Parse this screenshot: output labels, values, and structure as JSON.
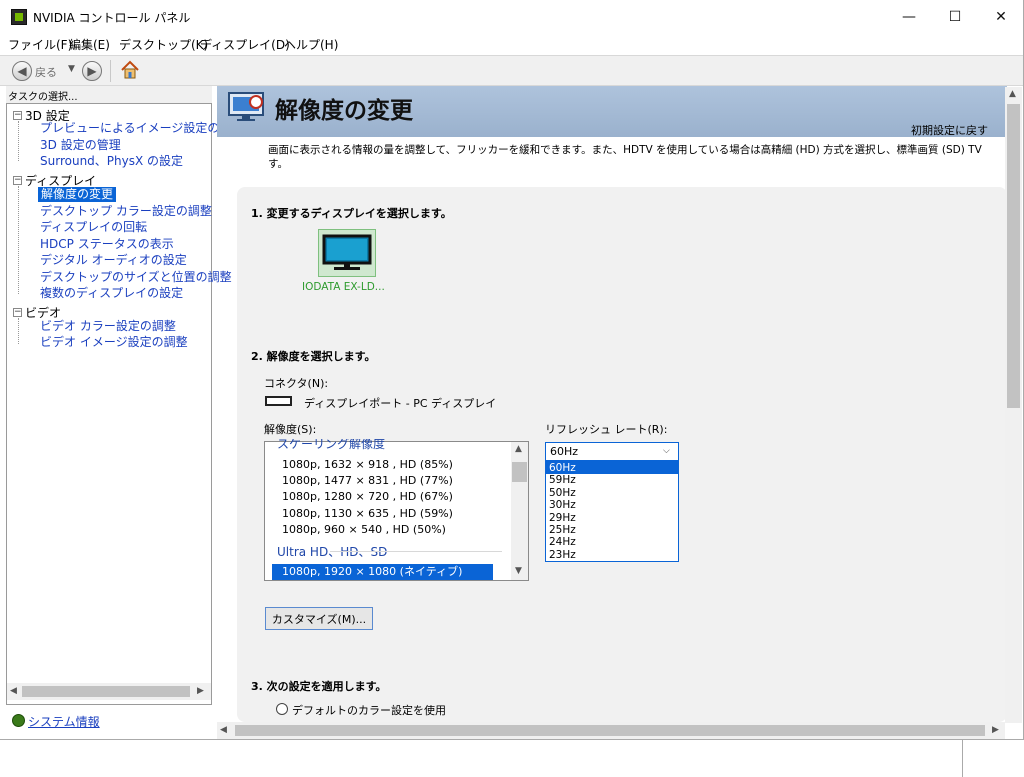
{
  "window": {
    "title": "NVIDIA コントロール パネル",
    "controls": {
      "minimize": "—",
      "maximize": "☐",
      "close": "✕"
    }
  },
  "menu": [
    "ファイル(F)",
    "編集(E)",
    "デスクトップ(K)",
    "ディスプレイ(D)",
    "ヘルプ(H)"
  ],
  "toolbar": {
    "back_label": "戻る",
    "back_icon": "arrow-left-icon",
    "forward_icon": "arrow-right-icon",
    "home_icon": "home-icon"
  },
  "left_panel": {
    "header": "タスクの選択...",
    "tree": [
      {
        "category": "3D 設定",
        "items": [
          "プレビューによるイメージ設定の調整",
          "3D 設定の管理",
          "Surround、PhysX の設定"
        ]
      },
      {
        "category": "ディスプレイ",
        "items": [
          "解像度の変更",
          "デスクトップ カラー設定の調整",
          "ディスプレイの回転",
          "HDCP ステータスの表示",
          "デジタル オーディオの設定",
          "デスクトップのサイズと位置の調整",
          "複数のディスプレイの設定"
        ],
        "selected": 0
      },
      {
        "category": "ビデオ",
        "items": [
          "ビデオ カラー設定の調整",
          "ビデオ イメージ設定の調整"
        ]
      }
    ],
    "system_info": "システム情報"
  },
  "content": {
    "title": "解像度の変更",
    "restore_default": "初期設定に戻す",
    "description": "画面に表示される情報の量を調整して、フリッカーを緩和できます。また、HDTV を使用している場合は高精細 (HD) 方式を選択し、標準画質 (SD) TV す。",
    "step1": "1. 変更するディスプレイを選択します。",
    "display_name": "IODATA EX-LD...",
    "step2": "2. 解像度を選択します。",
    "connector_label": "コネクタ(N):",
    "connector_value": "ディスプレイポート - PC ディスプレイ",
    "resolution_label": "解像度(S):",
    "resolution_groups": [
      {
        "label": "スケーリング解像度",
        "items": [
          "1080p, 1632 × 918 , HD (85%)",
          "1080p, 1477 × 831 , HD (77%)",
          "1080p, 1280 × 720 , HD (67%)",
          "1080p, 1130 × 635 , HD (59%)",
          "1080p, 960 × 540 , HD (50%)"
        ]
      },
      {
        "label": "Ultra HD、HD、SD",
        "items": [
          "1080p, 1920 × 1080 (ネイティブ)"
        ]
      }
    ],
    "refresh_label": "リフレッシュ レート(R):",
    "refresh_selected": "60Hz",
    "refresh_options": [
      "60Hz",
      "59Hz",
      "50Hz",
      "30Hz",
      "29Hz",
      "25Hz",
      "24Hz",
      "23Hz"
    ],
    "customize_button": "カスタマイズ(M)...",
    "step3": "3. 次の設定を適用します。",
    "radio_default_color": "デフォルトのカラー設定を使用"
  }
}
